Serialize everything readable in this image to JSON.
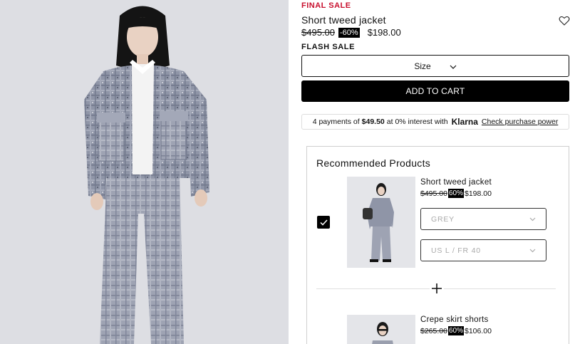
{
  "product": {
    "badge": "FINAL SALE",
    "title": "Short tweed jacket",
    "old_price": "$495.00",
    "discount": "-60%",
    "price": "$198.00",
    "flash_label": "FLASH SALE",
    "size_label": "Size",
    "cart_label": "ADD TO CART"
  },
  "klarna": {
    "prefix": "4 payments of",
    "amount": "$49.50",
    "middle": "at 0% interest with",
    "brand": "Klarna",
    "link": "Check purchase power"
  },
  "recommended": {
    "title": "Recommended Products",
    "items": [
      {
        "name": "Short tweed jacket",
        "old_price": "$495.00",
        "discount": "60%",
        "price": "$198.00",
        "color": "GREY",
        "size": "US L / FR 40",
        "checked": true
      },
      {
        "name": "Crepe skirt shorts",
        "old_price": "$265.00",
        "discount": "60%",
        "price": "$106.00"
      }
    ]
  },
  "icons": {
    "wishlist": "heart-icon",
    "dropdown": "chevron-down-icon",
    "check": "check-icon",
    "add": "plus-icon"
  },
  "colors": {
    "sale_red": "#c8102e",
    "black": "#000000",
    "tweed_grey": "#8e94a6"
  }
}
